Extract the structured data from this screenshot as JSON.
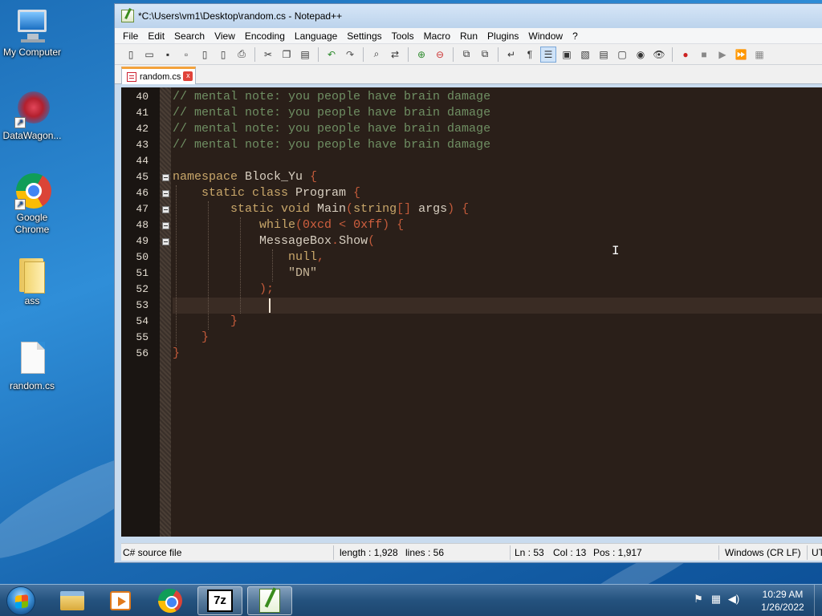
{
  "desktop": {
    "icons": [
      {
        "label": "My Computer",
        "icon": "computer-icon"
      },
      {
        "label": "DataWagon...",
        "icon": "datawagon-icon"
      },
      {
        "label": "Google Chrome",
        "icon": "chrome-icon"
      },
      {
        "label": "ass",
        "icon": "folder-icon"
      },
      {
        "label": "random.cs",
        "icon": "file-icon"
      }
    ]
  },
  "window": {
    "title": "*C:\\Users\\vm1\\Desktop\\random.cs - Notepad++",
    "menu": [
      "File",
      "Edit",
      "Search",
      "View",
      "Encoding",
      "Language",
      "Settings",
      "Tools",
      "Macro",
      "Run",
      "Plugins",
      "Window",
      "?"
    ],
    "toolbar_icons": [
      "new-file-icon",
      "open-file-icon",
      "save-icon",
      "save-all-icon",
      "close-icon",
      "close-all-icon",
      "print-icon",
      "cut-icon",
      "copy-icon",
      "paste-icon",
      "undo-icon",
      "redo-icon",
      "find-icon",
      "replace-icon",
      "zoom-in-icon",
      "zoom-out-icon",
      "sync-v-icon",
      "sync-h-icon",
      "word-wrap-icon",
      "show-all-chars-icon",
      "indent-guide-icon",
      "udl-icon",
      "doc-map-icon",
      "function-list-icon",
      "folder-workspace-icon",
      "monitoring-icon",
      "record-macro-icon",
      "stop-macro-icon",
      "play-macro-icon",
      "run-macro-multiple-icon",
      "save-macro-icon"
    ],
    "tab": {
      "label": "random.cs",
      "close": "x"
    }
  },
  "editor": {
    "lines": [
      {
        "no": "40",
        "tokens": [
          {
            "t": "// mental note: you people have brain damage",
            "c": "comment"
          }
        ]
      },
      {
        "no": "41",
        "tokens": [
          {
            "t": "// mental note: you people have brain damage",
            "c": "comment"
          }
        ]
      },
      {
        "no": "42",
        "tokens": [
          {
            "t": "// mental note: you people have brain damage",
            "c": "comment"
          }
        ]
      },
      {
        "no": "43",
        "tokens": [
          {
            "t": "// mental note: you people have brain damage",
            "c": "comment"
          }
        ]
      },
      {
        "no": "44",
        "tokens": []
      },
      {
        "no": "45",
        "fold": true,
        "tokens": [
          {
            "t": "namespace",
            "c": "kw"
          },
          {
            "t": " Block_Yu ",
            "c": "id"
          },
          {
            "t": "{",
            "c": "op"
          }
        ]
      },
      {
        "no": "46",
        "fold": true,
        "tokens": [
          {
            "t": "    static class ",
            "c": "kw"
          },
          {
            "t": "Program ",
            "c": "id"
          },
          {
            "t": "{",
            "c": "op"
          }
        ]
      },
      {
        "no": "47",
        "fold": true,
        "tokens": [
          {
            "t": "        static void ",
            "c": "kw"
          },
          {
            "t": "Main",
            "c": "id"
          },
          {
            "t": "(",
            "c": "op"
          },
          {
            "t": "string",
            "c": "kw"
          },
          {
            "t": "[] ",
            "c": "op"
          },
          {
            "t": "args",
            "c": "id"
          },
          {
            "t": ") {",
            "c": "op"
          }
        ]
      },
      {
        "no": "48",
        "fold": true,
        "tokens": [
          {
            "t": "            while",
            "c": "kw"
          },
          {
            "t": "(",
            "c": "op"
          },
          {
            "t": "0xcd",
            "c": "num"
          },
          {
            "t": " < ",
            "c": "op"
          },
          {
            "t": "0xff",
            "c": "num"
          },
          {
            "t": ") {",
            "c": "op"
          }
        ]
      },
      {
        "no": "49",
        "fold": true,
        "tokens": [
          {
            "t": "            MessageBox",
            "c": "id"
          },
          {
            "t": ".",
            "c": "op"
          },
          {
            "t": "Show",
            "c": "id"
          },
          {
            "t": "(",
            "c": "op"
          }
        ]
      },
      {
        "no": "50",
        "tokens": [
          {
            "t": "                null",
            "c": "kw"
          },
          {
            "t": ",",
            "c": "op"
          }
        ]
      },
      {
        "no": "51",
        "tokens": [
          {
            "t": "                \"DN\"",
            "c": "str"
          }
        ]
      },
      {
        "no": "52",
        "tokens": [
          {
            "t": "            );",
            "c": "op"
          }
        ]
      },
      {
        "no": "53",
        "current": true,
        "tokens": []
      },
      {
        "no": "54",
        "tokens": [
          {
            "t": "        }",
            "c": "op"
          }
        ]
      },
      {
        "no": "55",
        "tokens": [
          {
            "t": "    }",
            "c": "op"
          }
        ]
      },
      {
        "no": "56",
        "tokens": [
          {
            "t": "}",
            "c": "op"
          }
        ]
      }
    ]
  },
  "status": {
    "file_type": "C# source file",
    "length": "length : 1,928",
    "lines": "lines : 56",
    "ln": "Ln : 53",
    "col": "Col : 13",
    "pos": "Pos : 1,917",
    "eol": "Windows (CR LF)",
    "encoding": "UT"
  },
  "taskbar": {
    "apps": [
      "explorer-icon",
      "media-player-icon",
      "chrome-icon",
      "7zip-icon",
      "notepadpp-icon"
    ],
    "sevenzip_label": "7z",
    "time": "10:29 AM",
    "date": "1/26/2022"
  },
  "colors": {
    "editor_bg": "#2a1f19",
    "comment": "#6f8f63",
    "keyword": "#c9a76a",
    "tab_accent": "#f3a23c"
  }
}
